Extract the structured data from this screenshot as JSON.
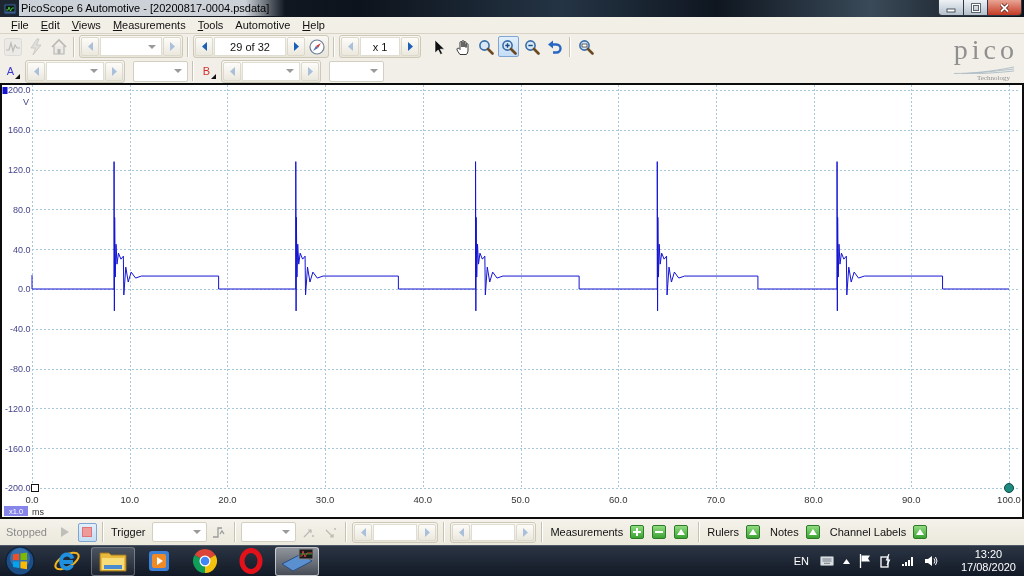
{
  "window": {
    "title": "PicoScope 6 Automotive - [20200817-0004.psdata]"
  },
  "menu": [
    {
      "label": "File",
      "mnemonic": true
    },
    {
      "label": "Edit",
      "mnemonic": true
    },
    {
      "label": "Views",
      "mnemonic": true
    },
    {
      "label": "Measurements",
      "mnemonic": true
    },
    {
      "label": "Tools",
      "mnemonic": true
    },
    {
      "label": "Automotive",
      "mnemonic": false
    },
    {
      "label": "Help",
      "mnemonic": true
    }
  ],
  "toolbar": {
    "view_buttons": [
      {
        "disabled": true
      },
      {
        "disabled": true
      },
      {
        "disabled": true
      }
    ],
    "timebase": {
      "back_disabled": true,
      "forward_disabled": true
    },
    "buffer": {
      "value": "29 of 32",
      "back_disabled": false,
      "forward_disabled": false
    },
    "zoom": {
      "value": "x 1",
      "back_disabled": true,
      "forward_disabled": false
    },
    "tools": [
      {
        "selected": false
      },
      {
        "selected": false
      },
      {
        "selected": false
      },
      {
        "selected": true
      },
      {
        "selected": false
      },
      {
        "selected": false
      },
      {
        "selected": false
      }
    ]
  },
  "channel_bar": [
    {
      "label": "A",
      "color": "#3a3ad0",
      "back_disabled": true,
      "forward_disabled": true
    },
    {
      "label": "B",
      "color": "#d03030",
      "back_disabled": true,
      "forward_disabled": true
    }
  ],
  "logo": {
    "wordmark": "pico",
    "tagline": "Technology"
  },
  "scope": {
    "zoom_badge": "x1.0",
    "chart_data": {
      "type": "line",
      "grid": true,
      "xlabel": "ms",
      "ylabel": "V",
      "xlim": [
        0,
        100
      ],
      "ylim": [
        -200,
        200
      ],
      "xticks": [
        {
          "value": 0,
          "label": "0.0"
        },
        {
          "value": 10,
          "label": "10.0"
        },
        {
          "value": 20,
          "label": "20.0"
        },
        {
          "value": 30,
          "label": "30.0"
        },
        {
          "value": 40,
          "label": "40.0"
        },
        {
          "value": 50,
          "label": "50.0"
        },
        {
          "value": 60,
          "label": "60.0"
        },
        {
          "value": 70,
          "label": "70.0"
        },
        {
          "value": 80,
          "label": "80.0"
        },
        {
          "value": 90,
          "label": "90.0"
        },
        {
          "value": 100,
          "label": "100.0"
        }
      ],
      "yticks": [
        {
          "value": 200,
          "label": "200.0"
        },
        {
          "value": 160,
          "label": "160.0"
        },
        {
          "value": 120,
          "label": "120.0"
        },
        {
          "value": 80,
          "label": "80.0"
        },
        {
          "value": 40,
          "label": "40.0"
        },
        {
          "value": 0,
          "label": "0.0"
        },
        {
          "value": -40,
          "label": "-40.0"
        },
        {
          "value": -80,
          "label": "-80.0"
        },
        {
          "value": -120,
          "label": "-120.0"
        },
        {
          "value": -160,
          "label": "-160.0"
        },
        {
          "value": -200,
          "label": "-200.0"
        }
      ],
      "x": [
        0,
        0,
        8.4,
        8.4,
        8.43,
        8.46,
        8.52,
        8.6,
        8.7,
        8.85,
        9.1,
        9.35,
        9.4,
        9.6,
        9.85,
        10.15,
        10.6,
        11.2,
        19.1,
        19.1,
        27,
        27,
        27.03,
        27.06,
        27.12,
        27.2,
        27.3,
        27.45,
        27.7,
        27.95,
        28,
        28.2,
        28.45,
        28.75,
        29.2,
        29.8,
        37.5,
        37.5,
        45.4,
        45.4,
        45.43,
        45.46,
        45.52,
        45.6,
        45.7,
        45.85,
        46.1,
        46.35,
        46.4,
        46.6,
        46.85,
        47.15,
        47.6,
        48.2,
        56,
        56,
        64,
        64,
        64.03,
        64.06,
        64.12,
        64.2,
        64.3,
        64.45,
        64.7,
        64.95,
        65,
        65.2,
        65.45,
        65.75,
        66.2,
        66.8,
        74.3,
        74.3,
        82.4,
        82.4,
        82.43,
        82.46,
        82.52,
        82.6,
        82.7,
        82.85,
        83.1,
        83.35,
        83.4,
        83.6,
        83.85,
        84.15,
        84.6,
        85.2,
        93.2,
        93.2,
        100
      ],
      "series": [
        {
          "color": "#1414d2",
          "values": [
            14,
            0,
            0,
            128,
            -22,
            72,
            12,
            45,
            25,
            36,
            30,
            33,
            -6,
            22,
            7,
            17,
            11,
            13,
            13,
            0,
            0,
            128,
            -22,
            72,
            12,
            45,
            25,
            36,
            30,
            33,
            -6,
            22,
            7,
            17,
            11,
            13,
            13,
            0,
            0,
            128,
            -22,
            72,
            12,
            45,
            25,
            36,
            30,
            33,
            -6,
            22,
            7,
            17,
            11,
            13,
            13,
            0,
            0,
            128,
            -22,
            72,
            12,
            45,
            25,
            36,
            30,
            33,
            -6,
            22,
            7,
            17,
            11,
            13,
            13,
            0,
            0,
            128,
            -22,
            72,
            12,
            45,
            25,
            36,
            30,
            33,
            -6,
            22,
            7,
            17,
            11,
            13,
            13,
            0,
            0
          ]
        }
      ]
    }
  },
  "status_bar": {
    "state": "Stopped",
    "start_disabled": true,
    "stop_selected": true,
    "trigger_label": "Trigger",
    "edge_buttons": [
      {
        "disabled": true
      },
      {
        "disabled": true
      }
    ],
    "spins": [
      {
        "back_disabled": true,
        "forward_disabled": true
      },
      {
        "back_disabled": true,
        "forward_disabled": true
      }
    ],
    "measurements_label": "Measurements",
    "panels": [
      {
        "label": "Rulers"
      },
      {
        "label": "Notes"
      },
      {
        "label": "Channel Labels"
      }
    ]
  },
  "taskbar": {
    "apps": [
      {
        "running": false,
        "selected": false
      },
      {
        "running": true,
        "selected": false
      },
      {
        "running": false,
        "selected": false
      },
      {
        "running": false,
        "selected": false
      },
      {
        "running": false,
        "selected": false
      },
      {
        "running": true,
        "selected": true
      }
    ],
    "language": "EN",
    "time": "13:20",
    "date": "17/08/2020"
  }
}
